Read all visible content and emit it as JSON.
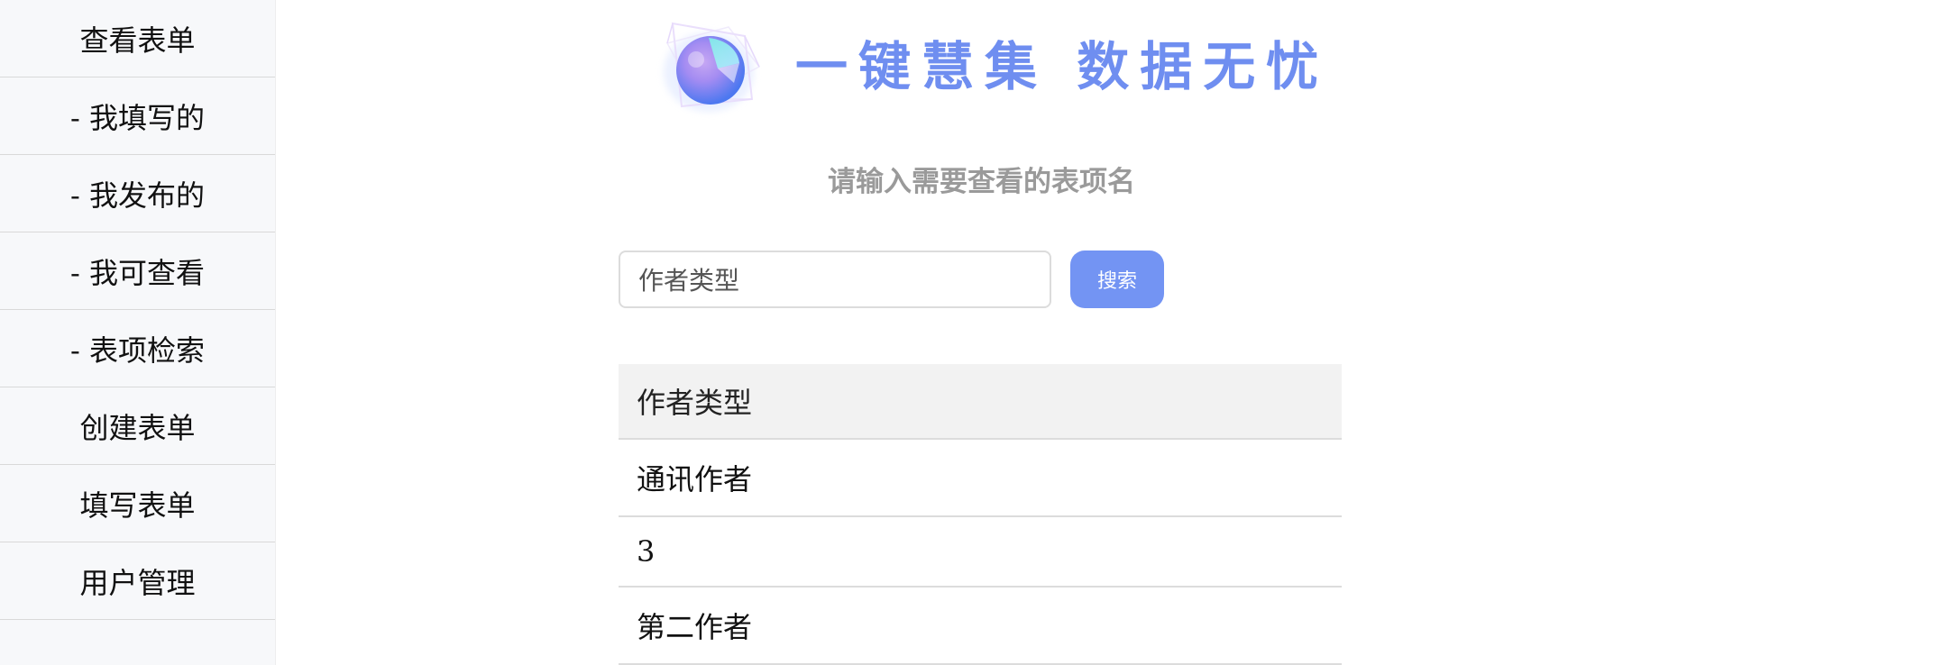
{
  "sidebar": {
    "items": [
      {
        "label": "查看表单"
      },
      {
        "label": "- 我填写的"
      },
      {
        "label": "- 我发布的"
      },
      {
        "label": "- 我可查看"
      },
      {
        "label": "- 表项检索"
      },
      {
        "label": "创建表单"
      },
      {
        "label": "填写表单"
      },
      {
        "label": "用户管理"
      }
    ]
  },
  "banner": {
    "slogan": "一键慧集  数据无忧",
    "logo_icon": "crystal-cube-sphere-icon"
  },
  "search": {
    "prompt": "请输入需要查看的表项名",
    "value": "作者类型",
    "button_label": "搜索"
  },
  "results": {
    "header": "作者类型",
    "rows": [
      "通讯作者",
      "3",
      "第二作者"
    ]
  },
  "colors": {
    "accent": "#7394f3",
    "slogan": "#6f8ef0",
    "sidebar_bg": "#f7f8fa",
    "header_bg": "#f2f2f2"
  }
}
